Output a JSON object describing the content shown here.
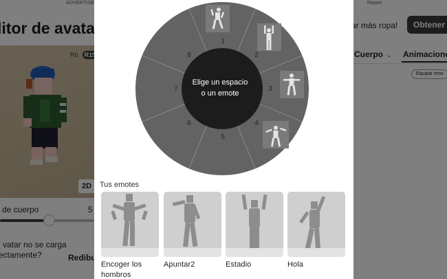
{
  "background": {
    "ad_label": "ADVERTISEM",
    "report_label": "Report",
    "page_title": "litor de avata",
    "rig_options": [
      "R6",
      "R15"
    ],
    "view_toggle": "2D",
    "scale_label": "de cuerpo",
    "scale_value": "5",
    "scale_level_percent": 52,
    "warning_line1": "vatar no se carga",
    "warning_line2": "ectamente?",
    "redraw_label": "Redibu",
    "buy_text": "ar más ropa!",
    "get_button": "Obtener r",
    "tabs": [
      "Cuerpo",
      "Animacione"
    ],
    "equip_button": "Equipar emo"
  },
  "modal": {
    "wheel": {
      "center_line1": "Elige un espacio",
      "center_line2": "o un emote",
      "slots": [
        "1",
        "2",
        "3",
        "4",
        "5",
        "6",
        "7",
        "8"
      ],
      "colors": {
        "outer": "#636363",
        "inner": "#1c1c1c",
        "divider": "#8a8a8a"
      }
    },
    "emotes_title": "Tus emotes",
    "emotes": [
      {
        "name": "Encoger los hombros",
        "icon": "shrug-figure-icon"
      },
      {
        "name": "Apuntar2",
        "icon": "point-figure-icon"
      },
      {
        "name": "Estadio",
        "icon": "stadium-figure-icon"
      },
      {
        "name": "Hola",
        "icon": "wave-figure-icon"
      }
    ]
  }
}
